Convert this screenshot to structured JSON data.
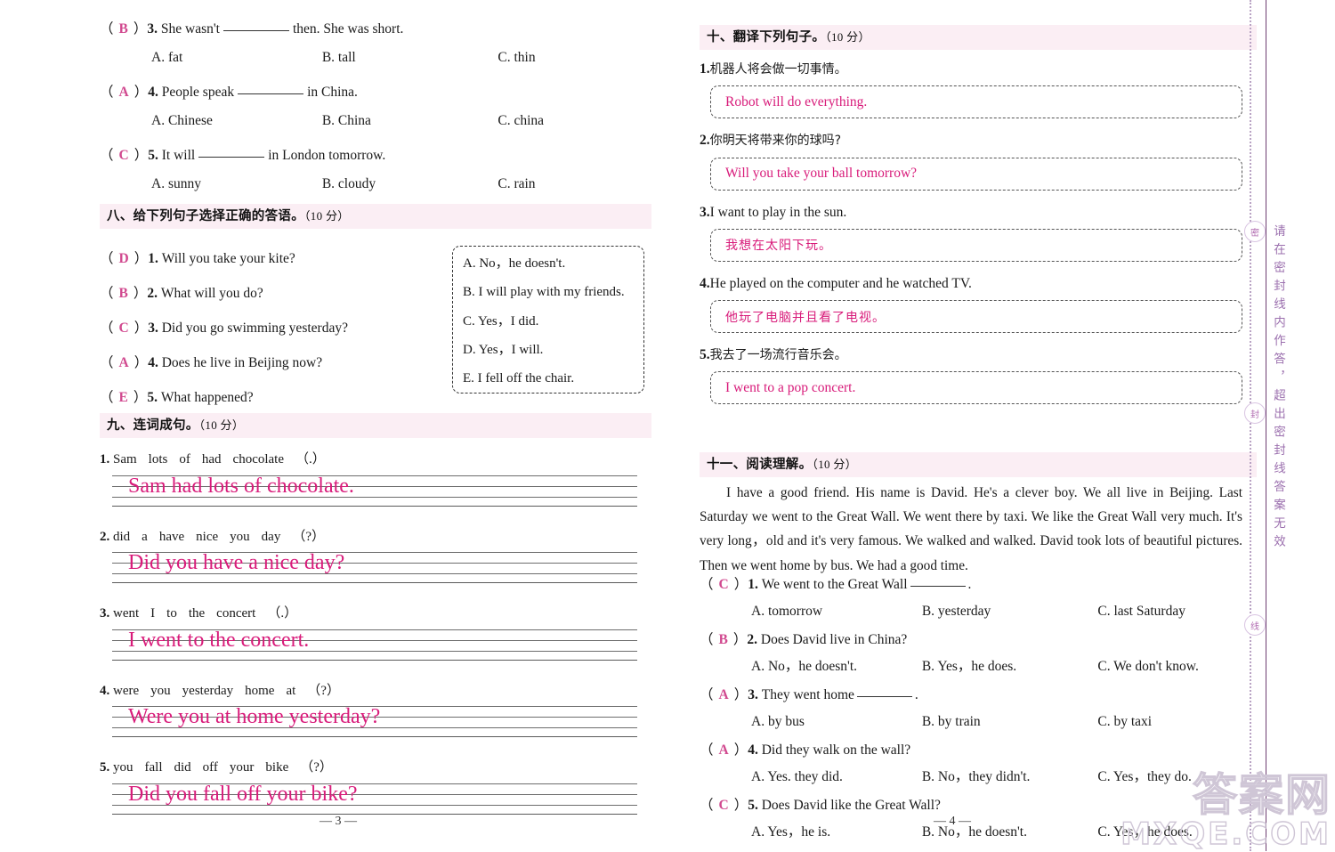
{
  "left_page": {
    "page_number": "— 3 —",
    "mc_tail": {
      "items": [
        {
          "mark": "B",
          "num": "3.",
          "stem_before": "She wasn't",
          "stem_after": "then. She was short.",
          "options": [
            "A. fat",
            "B. tall",
            "C. thin"
          ]
        },
        {
          "mark": "A",
          "num": "4.",
          "stem_before": "People speak",
          "stem_after": "in China.",
          "options": [
            "A. Chinese",
            "B. China",
            "C. china"
          ]
        },
        {
          "mark": "C",
          "num": "5.",
          "stem_before": "It will",
          "stem_after": "in London tomorrow.",
          "options": [
            "A. sunny",
            "B. cloudy",
            "C. rain"
          ]
        }
      ]
    },
    "section8": {
      "title": "八、给下列句子选择正确的答语。",
      "points": "（10 分）",
      "questions": [
        {
          "mark": "D",
          "num": "1.",
          "text": "Will you take your kite?"
        },
        {
          "mark": "B",
          "num": "2.",
          "text": "What will you do?"
        },
        {
          "mark": "C",
          "num": "3.",
          "text": "Did you go swimming yesterday?"
        },
        {
          "mark": "A",
          "num": "4.",
          "text": "Does he live in Beijing now?"
        },
        {
          "mark": "E",
          "num": "5.",
          "text": "What happened?"
        }
      ],
      "choices": [
        "A. No，he doesn't.",
        "B. I will play with my friends.",
        "C. Yes，I did.",
        "D. Yes，I will.",
        "E. I fell off the chair."
      ]
    },
    "section9": {
      "title": "九、连词成句。",
      "points": "（10 分）",
      "items": [
        {
          "num": "1.",
          "words": [
            "Sam",
            "lots",
            "of",
            "had",
            "chocolate",
            "（.）"
          ],
          "answer": "Sam had lots of chocolate."
        },
        {
          "num": "2.",
          "words": [
            "did",
            "a",
            "have",
            "nice",
            "you",
            "day",
            "（?）"
          ],
          "answer": "Did you have a nice day?"
        },
        {
          "num": "3.",
          "words": [
            "went",
            "I",
            "to",
            "the",
            "concert",
            "（.）"
          ],
          "answer": "I went to the concert."
        },
        {
          "num": "4.",
          "words": [
            "were",
            "you",
            "yesterday",
            "home",
            "at",
            "（?）"
          ],
          "answer": "Were you at home yesterday?"
        },
        {
          "num": "5.",
          "words": [
            "you",
            "fall",
            "did",
            "off",
            "your",
            "bike",
            "（?）"
          ],
          "answer": "Did you fall off your bike?"
        }
      ]
    }
  },
  "right_page": {
    "page_number": "— 4 —",
    "section10": {
      "title": "十、翻译下列句子。",
      "points": "（10 分）",
      "items": [
        {
          "num": "1.",
          "prompt": "机器人将会做一切事情。",
          "prompt_lang": "cn",
          "answer": "Robot will do everything.",
          "answer_lang": "en"
        },
        {
          "num": "2.",
          "prompt": "你明天将带来你的球吗?",
          "prompt_lang": "cn",
          "answer": "Will you take your ball tomorrow?",
          "answer_lang": "en"
        },
        {
          "num": "3.",
          "prompt": "I want to play in the sun.",
          "prompt_lang": "en",
          "answer": "我想在太阳下玩。",
          "answer_lang": "cn"
        },
        {
          "num": "4.",
          "prompt": "He played on the computer and he watched TV.",
          "prompt_lang": "en",
          "answer": "他玩了电脑并且看了电视。",
          "answer_lang": "cn"
        },
        {
          "num": "5.",
          "prompt": "我去了一场流行音乐会。",
          "prompt_lang": "cn",
          "answer": "I went to a pop concert.",
          "answer_lang": "en"
        }
      ]
    },
    "section11": {
      "title": "十一、阅读理解。",
      "points": "（10 分）",
      "passage": "I have a good friend. His name is David. He's a clever boy. We all live in Beijing. Last Saturday we went to the Great Wall. We went there by taxi. We like the Great Wall very much. It's very long，old and it's very famous. We walked and walked. David took lots of beautiful pictures. Then we went home by bus. We had a good time.",
      "questions": [
        {
          "mark": "C",
          "num": "1.",
          "stem_before": "We went to the Great Wall",
          "stem_after": ".",
          "options": [
            "A. tomorrow",
            "B. yesterday",
            "C. last Saturday"
          ]
        },
        {
          "mark": "B",
          "num": "2.",
          "stem_before": "Does David live in China?",
          "stem_after": "",
          "options": [
            "A. No，he doesn't.",
            "B. Yes，he does.",
            "C. We don't know."
          ]
        },
        {
          "mark": "A",
          "num": "3.",
          "stem_before": "They went home",
          "stem_after": ".",
          "options": [
            "A. by bus",
            "B. by train",
            "C. by taxi"
          ]
        },
        {
          "mark": "A",
          "num": "4.",
          "stem_before": "Did they walk on the wall?",
          "stem_after": "",
          "options": [
            "A. Yes. they did.",
            "B. No，they didn't.",
            "C. Yes，they do."
          ]
        },
        {
          "mark": "C",
          "num": "5.",
          "stem_before": "Does David like the Great Wall?",
          "stem_after": "",
          "options": [
            "A. Yes，he is.",
            "B. No，he doesn't.",
            "C. Yes，he does."
          ]
        }
      ]
    }
  },
  "seal_strip": {
    "vertical_text": "请在密封线内作答，超出密封线答案无效",
    "stamps": [
      "密",
      "封",
      "线"
    ]
  },
  "watermark": {
    "line1": "答案网",
    "line2": "MXQE.COM"
  },
  "colors": {
    "answer_ink": "#d81b7a",
    "mc_mark": "#d1498f",
    "section_band": "#fbeef4",
    "seal_line": "#6e3f72"
  }
}
